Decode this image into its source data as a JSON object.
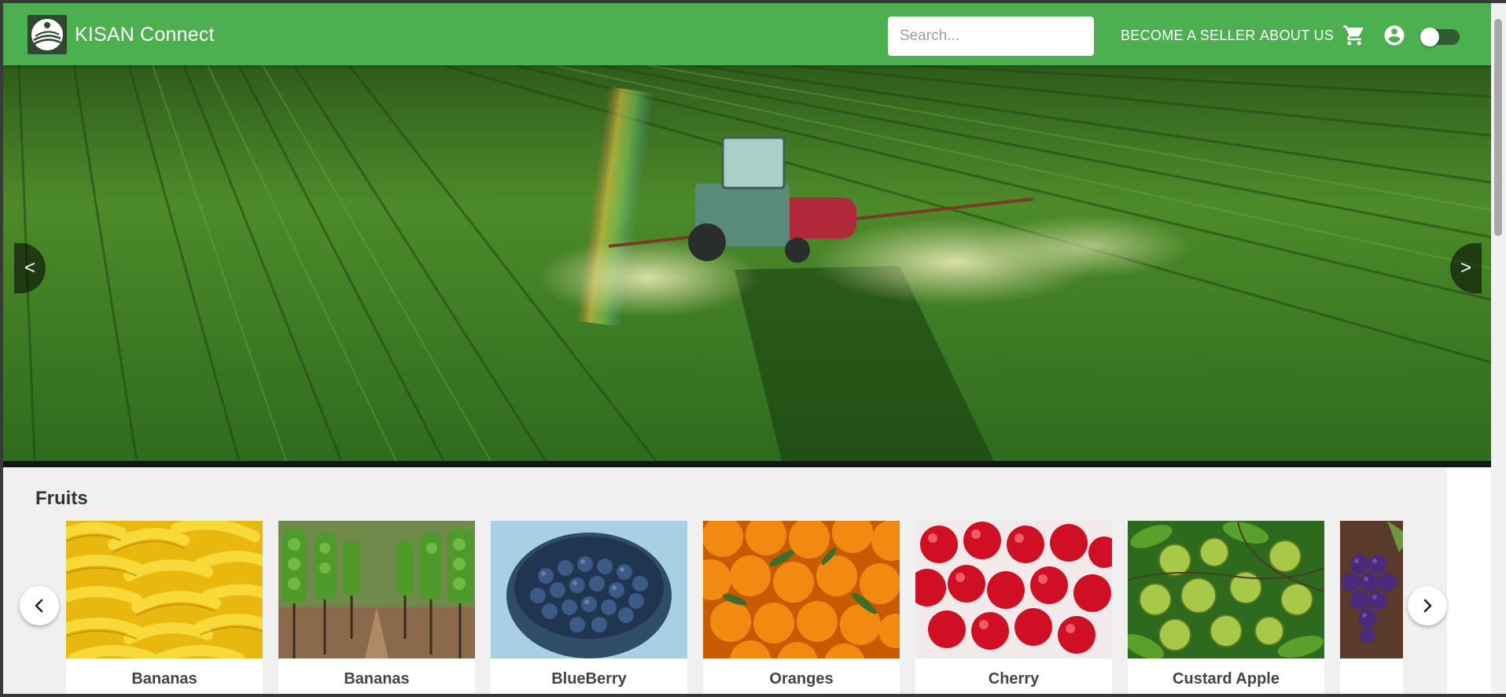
{
  "header": {
    "brand": "KISAN Connect",
    "search_placeholder": "Search...",
    "nav": [
      "BECOME A SELLER",
      "ABOUT US"
    ],
    "icons": [
      "cart-icon",
      "account-circle-icon",
      "theme-toggle"
    ],
    "color": "#4caf50"
  },
  "hero": {
    "prev_label": "<",
    "next_label": ">"
  },
  "fruits": {
    "title": "Fruits",
    "items": [
      {
        "name": "Bananas"
      },
      {
        "name": "Bananas"
      },
      {
        "name": "BlueBerry"
      },
      {
        "name": "Oranges"
      },
      {
        "name": "Cherry"
      },
      {
        "name": "Custard Apple"
      },
      {
        "name": ""
      }
    ]
  }
}
